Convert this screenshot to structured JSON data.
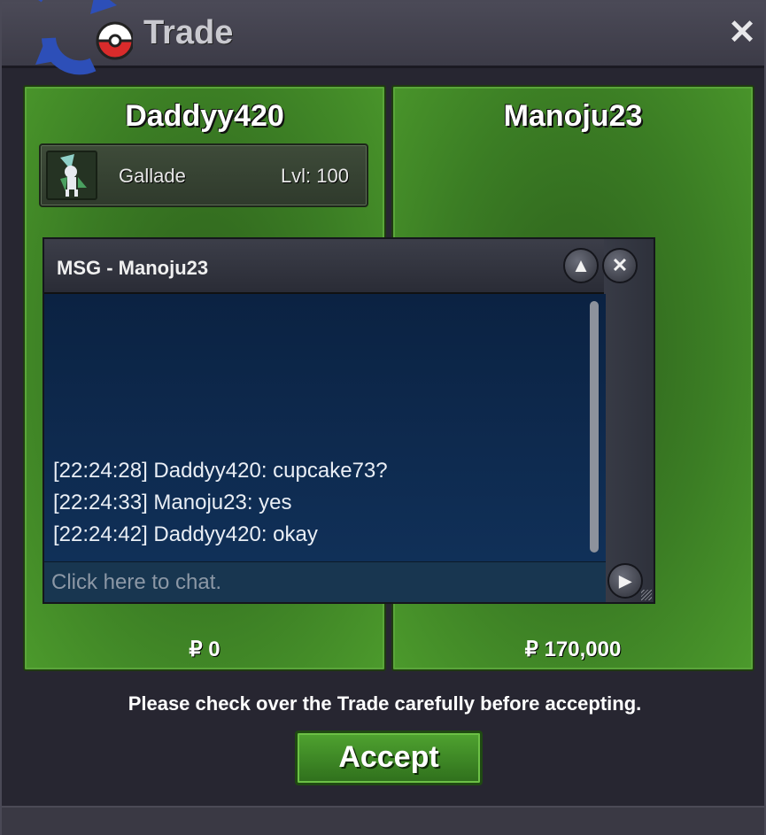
{
  "window": {
    "title": "Trade",
    "close_glyph": "✕"
  },
  "left_panel": {
    "trainer": "Daddyy420",
    "pokemon": {
      "name": "Gallade",
      "level": "Lvl: 100",
      "icon": "gallade-sprite-icon"
    },
    "money": "₽ 0"
  },
  "right_panel": {
    "trainer": "Manoju23",
    "money": "₽ 170,000"
  },
  "chat": {
    "title": "MSG - Manoju23",
    "messages": [
      "[22:24:28] Daddyy420: cupcake73?",
      "[22:24:33] Manoju23: yes",
      "[22:24:42] Daddyy420: okay"
    ],
    "input_placeholder": "Click here to chat.",
    "minimize_glyph": "▲",
    "close_glyph": "✕",
    "send_glyph": "▶"
  },
  "footer": {
    "notice": "Please check over the Trade carefully before accepting.",
    "accept_label": "Accept"
  },
  "colors": {
    "panel_green": "#3b7d24",
    "chat_blue": "#0b2242",
    "window_bg": "#272631"
  }
}
